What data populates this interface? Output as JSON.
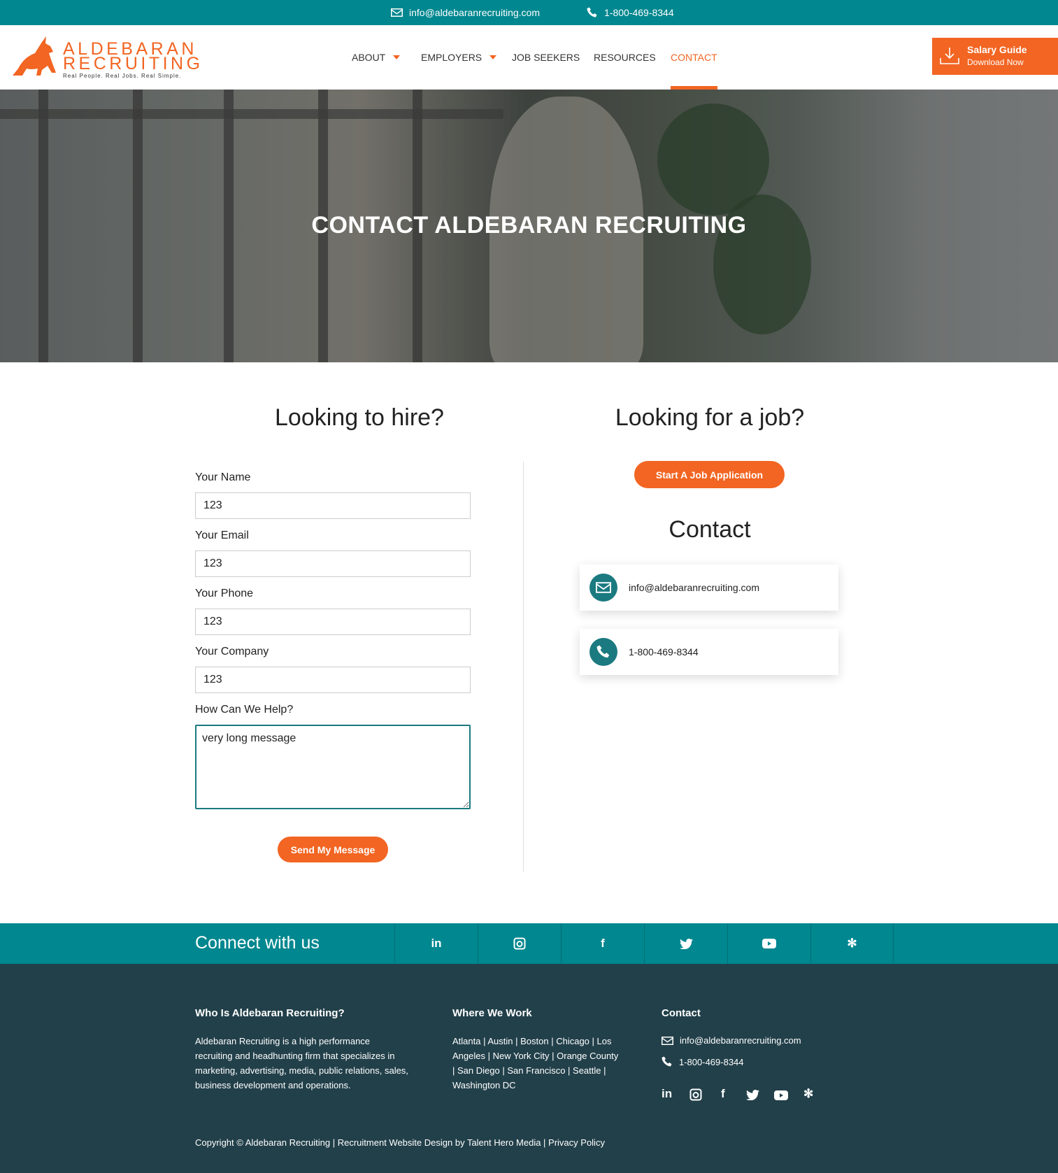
{
  "topbar": {
    "email": "info@aldebaranrecruiting.com",
    "phone": "1-800-469-8344"
  },
  "logo": {
    "line1": "ALDEBARAN",
    "line2": "RECRUITING",
    "tagline": "Real People. Real Jobs. Real Simple."
  },
  "nav": {
    "items": [
      {
        "label": "ABOUT",
        "dropdown": true
      },
      {
        "label": "EMPLOYERS",
        "dropdown": true
      },
      {
        "label": "JOB SEEKERS",
        "dropdown": false
      },
      {
        "label": "RESOURCES",
        "dropdown": false
      },
      {
        "label": "CONTACT",
        "dropdown": false,
        "active": true
      }
    ]
  },
  "salary_guide": {
    "title": "Salary Guide",
    "subtitle": "Download Now"
  },
  "hero": {
    "title": "CONTACT ALDEBARAN RECRUITING"
  },
  "hire": {
    "title": "Looking to hire?",
    "fields": [
      {
        "label": "Your Name",
        "value": "123"
      },
      {
        "label": "Your Email",
        "value": "123"
      },
      {
        "label": "Your Phone",
        "value": "123"
      },
      {
        "label": "Your Company",
        "value": "123"
      }
    ],
    "message_label": "How Can We Help?",
    "message_value": "very long message",
    "submit": "Send My Message"
  },
  "job": {
    "title": "Looking for a job?",
    "apply_button": "Start A Job Application",
    "contact_title": "Contact",
    "email": "info@aldebaranrecruiting.com",
    "phone": "1-800-469-8344"
  },
  "connect": {
    "title": "Connect with us",
    "networks": [
      "linkedin-icon",
      "instagram-icon",
      "facebook-icon",
      "twitter-icon",
      "youtube-icon",
      "yelp-icon"
    ]
  },
  "footer": {
    "about_title": "Who Is Aldebaran Recruiting?",
    "about_text": "Aldebaran Recruiting is a high performance recruiting and headhunting firm that specializes in marketing, advertising, media, public relations, sales, business development and operations.",
    "where_title": "Where We Work",
    "cities": [
      "Atlanta",
      "Austin",
      "Boston",
      "Chicago",
      "Los Angeles",
      "New York City",
      "Orange County",
      "San Diego",
      "San Francisco",
      "Seattle",
      "Washington DC"
    ],
    "contact_title": "Contact",
    "email": "info@aldebaranrecruiting.com",
    "phone": "1-800-469-8344",
    "copyright": "Copyright © Aldebaran Recruiting | Recruitment Website Design by Talent Hero Media | Privacy Policy"
  },
  "colors": {
    "teal": "#00878f",
    "orange": "#f26522",
    "footer": "#22404a",
    "icon_circle": "#1b7a80"
  }
}
